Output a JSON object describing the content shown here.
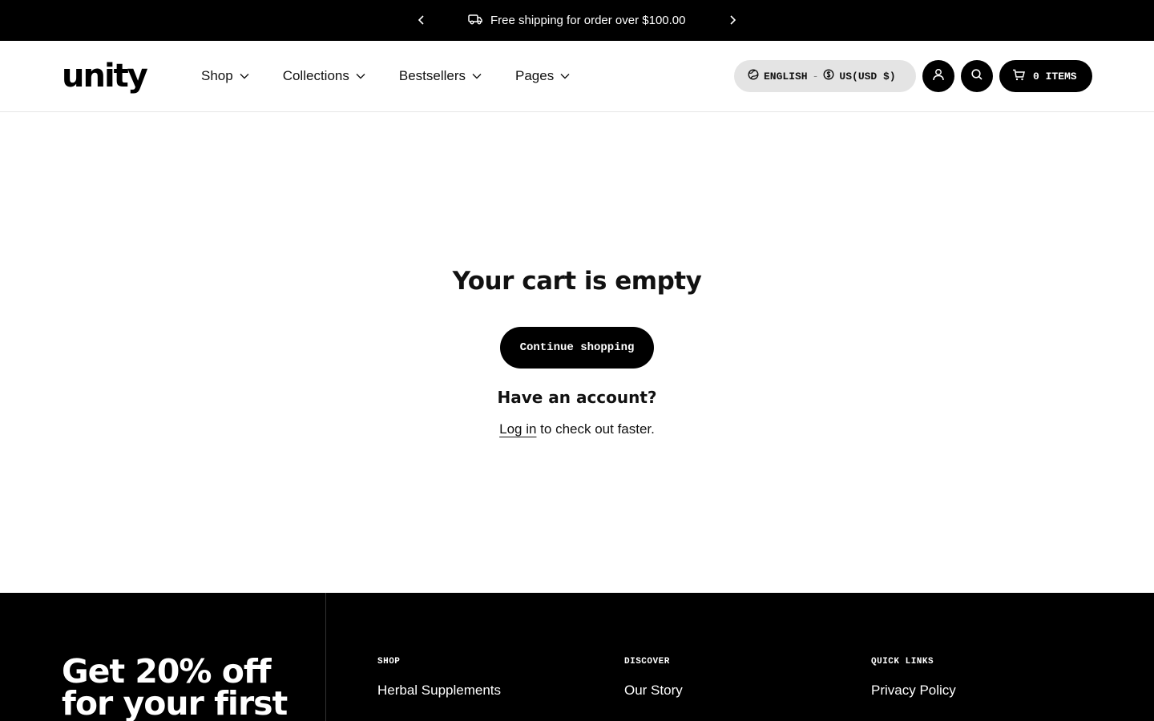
{
  "announcement": {
    "text": "Free shipping for order over $100.00",
    "prev_icon": "chevron-left-icon",
    "next_icon": "chevron-right-icon",
    "truck_icon": "truck-icon"
  },
  "header": {
    "logo": "unity",
    "nav": [
      {
        "label": "Shop"
      },
      {
        "label": "Collections"
      },
      {
        "label": "Bestsellers"
      },
      {
        "label": "Pages"
      }
    ],
    "locale": {
      "language": "ENGLISH",
      "separator": "-",
      "currency": "US(USD $)"
    },
    "cart_label": "0 ITEMS"
  },
  "main": {
    "title": "Your cart is empty",
    "continue_label": "Continue shopping",
    "account_title": "Have an account?",
    "login_link": "Log in",
    "login_suffix": " to check out faster."
  },
  "footer": {
    "promo_line1": "Get 20% off",
    "promo_line2": "for your first",
    "columns": [
      {
        "heading": "SHOP",
        "link": "Herbal Supplements"
      },
      {
        "heading": "DISCOVER",
        "link": "Our Story"
      },
      {
        "heading": "QUICK LINKS",
        "link": "Privacy Policy"
      }
    ]
  },
  "colors": {
    "primary": "#000000",
    "background": "#ffffff",
    "pill_gray": "#e4e4e4"
  }
}
